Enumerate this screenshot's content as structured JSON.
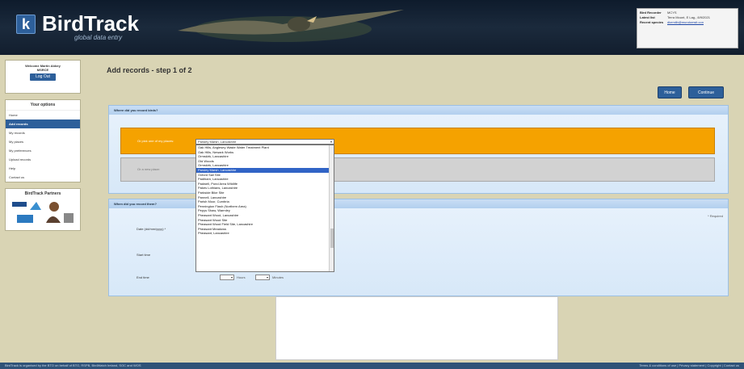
{
  "header": {
    "logo_glyph": "k",
    "app_name": "BirdTrack",
    "tagline": "global data entry",
    "user_info": [
      {
        "key": "Bird Recorder",
        "value": "MCYS",
        "link": false
      },
      {
        "key": "Latest list",
        "value": "Terra Mount, E Lag., 8/9/2021",
        "link": false
      },
      {
        "key": "Recent species",
        "value": "dkemilb@mundomsit.con",
        "link": true
      }
    ]
  },
  "sidebar": {
    "welcome_lines": [
      "Welcome Martin Abbey",
      "MSRCE"
    ],
    "logout_label": "Log Out",
    "options_title": "Your options",
    "items": [
      {
        "label": "Home",
        "active": false
      },
      {
        "label": "Add records",
        "active": true
      },
      {
        "label": "My records",
        "active": false
      },
      {
        "label": "My places",
        "active": false
      },
      {
        "label": "My preferences",
        "active": false
      },
      {
        "label": "Upload records",
        "active": false
      },
      {
        "label": "Help",
        "active": false
      },
      {
        "label": "Contact us",
        "active": false
      }
    ],
    "partners_title": "BirdTrack Partners"
  },
  "main": {
    "title": "Add records - step 1 of 2",
    "home_button": "Home",
    "continue_button": "Continue",
    "section1_title": "Where did you record birds?",
    "orange_label": "Or pick one of my places:",
    "grey_label": "Or a new place:",
    "select_value": "Parsley Marsh, Lancashire",
    "dropdown_items": [
      "Oak Hills, Anglesey Waste Water Treatment Plant",
      "Oak Hills, Newark Works",
      "Ormskirk, Lancashire",
      "Old Woods",
      "Ormskirk, Lancashire",
      "Parsley Marsh, Lancashire",
      "Oxford Sail Site",
      "Padiham, Lancashire",
      "Padwell, Pond Area Wildlife",
      "Pakes Lothians, Lancashire",
      "Parkside Bike Site",
      "Pannell, Lancashire",
      "Parish Moor, Cumbria",
      "Pennington Flash (Northern Area)",
      "Pepys Shaw, Warmley",
      "Pheasant Wood, Lancashire",
      "Pheasant Wood Site",
      "Pheasant Wood Field Site, Lancashire",
      "Pheasant Meadows",
      "Pheasant, Lancashire"
    ],
    "selected_index": 5,
    "section2_title": "When did you record them?",
    "required_note": "* Required",
    "date_label": "Date (dd/mm/yyyy) *",
    "start_label": "Start time",
    "end_label": "End time",
    "hours_label": "Hours",
    "minutes_label": "Minutes"
  },
  "footer": {
    "left": "BirdTrack is organised by the BTO on behalf of BTO, RSPB, BirdWatch Ireland, SOC and WOS",
    "right": "Terms & conditions of use | Privacy statement | Copyright | Contact us"
  }
}
